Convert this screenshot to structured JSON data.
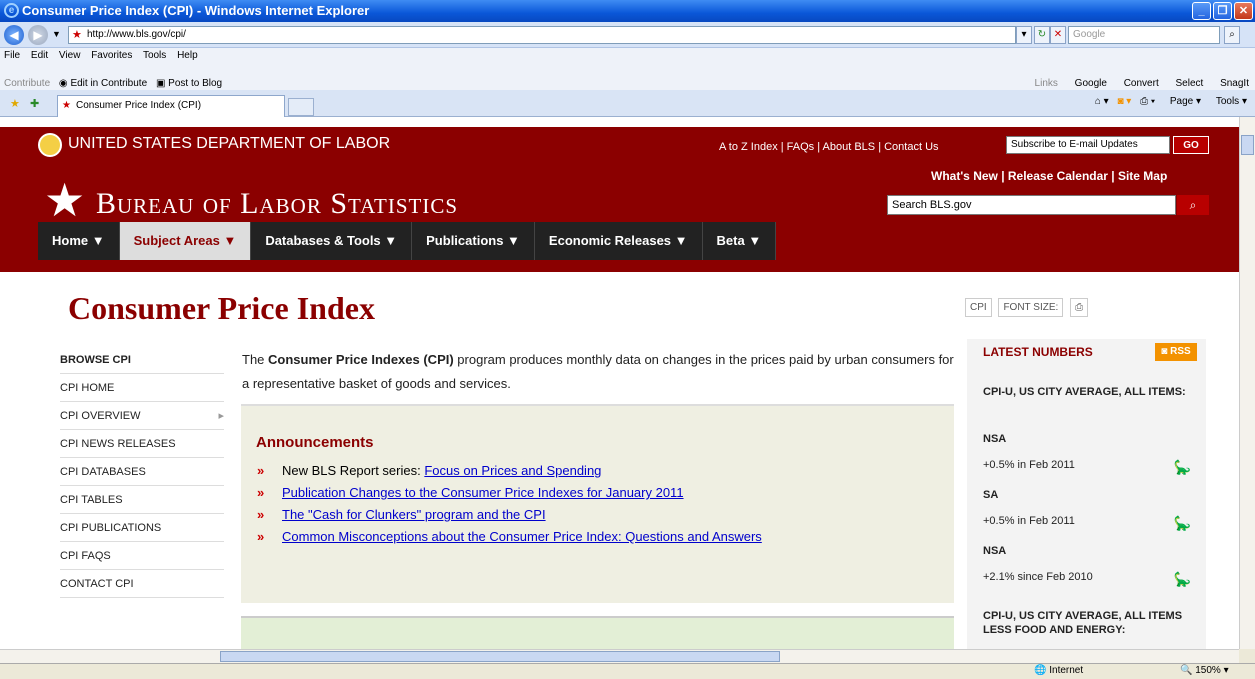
{
  "window": {
    "title": "Consumer Price Index (CPI) - Windows Internet Explorer"
  },
  "address": {
    "url": "http://www.bls.gov/cpi/",
    "search_placeholder": "Google"
  },
  "menu": [
    "File",
    "Edit",
    "View",
    "Favorites",
    "Tools",
    "Help"
  ],
  "contribute": {
    "label": "Contribute",
    "edit": "Edit in Contribute",
    "post": "Post to Blog"
  },
  "links_bar": {
    "links": "Links",
    "google": "Google",
    "convert": "Convert",
    "select": "Select",
    "snagit": "SnagIt"
  },
  "tab": {
    "label": "Consumer Price Index (CPI)"
  },
  "tab_tools": {
    "page": "Page",
    "tools": "Tools"
  },
  "header": {
    "department": "UNITED STATES DEPARTMENT OF LABOR",
    "top_links": "A to Z Index | FAQs | About BLS | Contact Us",
    "subscribe_placeholder": "Subscribe to E-mail Updates",
    "go": "GO",
    "bureau": "Bureau of Labor Statistics",
    "quick_links": "What's New | Release Calendar | Site Map",
    "search_placeholder": "Search BLS.gov"
  },
  "nav": [
    {
      "label": "Home ▼"
    },
    {
      "label": "Subject Areas ▼"
    },
    {
      "label": "Databases & Tools ▼"
    },
    {
      "label": "Publications ▼"
    },
    {
      "label": "Economic Releases ▼"
    },
    {
      "label": "Beta ▼"
    }
  ],
  "page": {
    "title": "Consumer Price Index",
    "tools": {
      "cpi": "CPI",
      "font_size": "FONT SIZE:"
    },
    "intro_bold": "Consumer Price Indexes (CPI)",
    "intro_pre": "The ",
    "intro_post": " program produces monthly data on changes in the prices paid by urban consumers for a representative basket of goods and services.",
    "announcements_title": "Announcements",
    "announcements": [
      {
        "pre": "New BLS Report series: ",
        "link": "Focus on Prices and Spending"
      },
      {
        "pre": "",
        "link": "Publication Changes to the Consumer Price Indexes for January 2011"
      },
      {
        "pre": "",
        "link": "The \"Cash for Clunkers\" program and the CPI"
      },
      {
        "pre": "",
        "link": "Common Misconceptions about the Consumer Price Index: Questions and Answers"
      }
    ]
  },
  "sidebar": {
    "head": "BROWSE CPI",
    "items": [
      "CPI HOME",
      "CPI OVERVIEW",
      "CPI NEWS RELEASES",
      "CPI DATABASES",
      "CPI TABLES",
      "CPI PUBLICATIONS",
      "CPI FAQS",
      "CONTACT CPI"
    ]
  },
  "latest": {
    "title": "LATEST NUMBERS",
    "rss": "RSS",
    "series1": "CPI-U, US CITY AVERAGE, ALL ITEMS:",
    "rows": [
      {
        "label": "NSA",
        "value": "+0.5% in Feb 2011"
      },
      {
        "label": "SA",
        "value": "+0.5% in Feb 2011"
      },
      {
        "label": "NSA",
        "value": "+2.1% since Feb 2010"
      }
    ],
    "series2": "CPI-U, US CITY AVERAGE, ALL ITEMS LESS FOOD AND ENERGY:"
  },
  "status": {
    "zone": "Internet",
    "zoom": "150%"
  }
}
